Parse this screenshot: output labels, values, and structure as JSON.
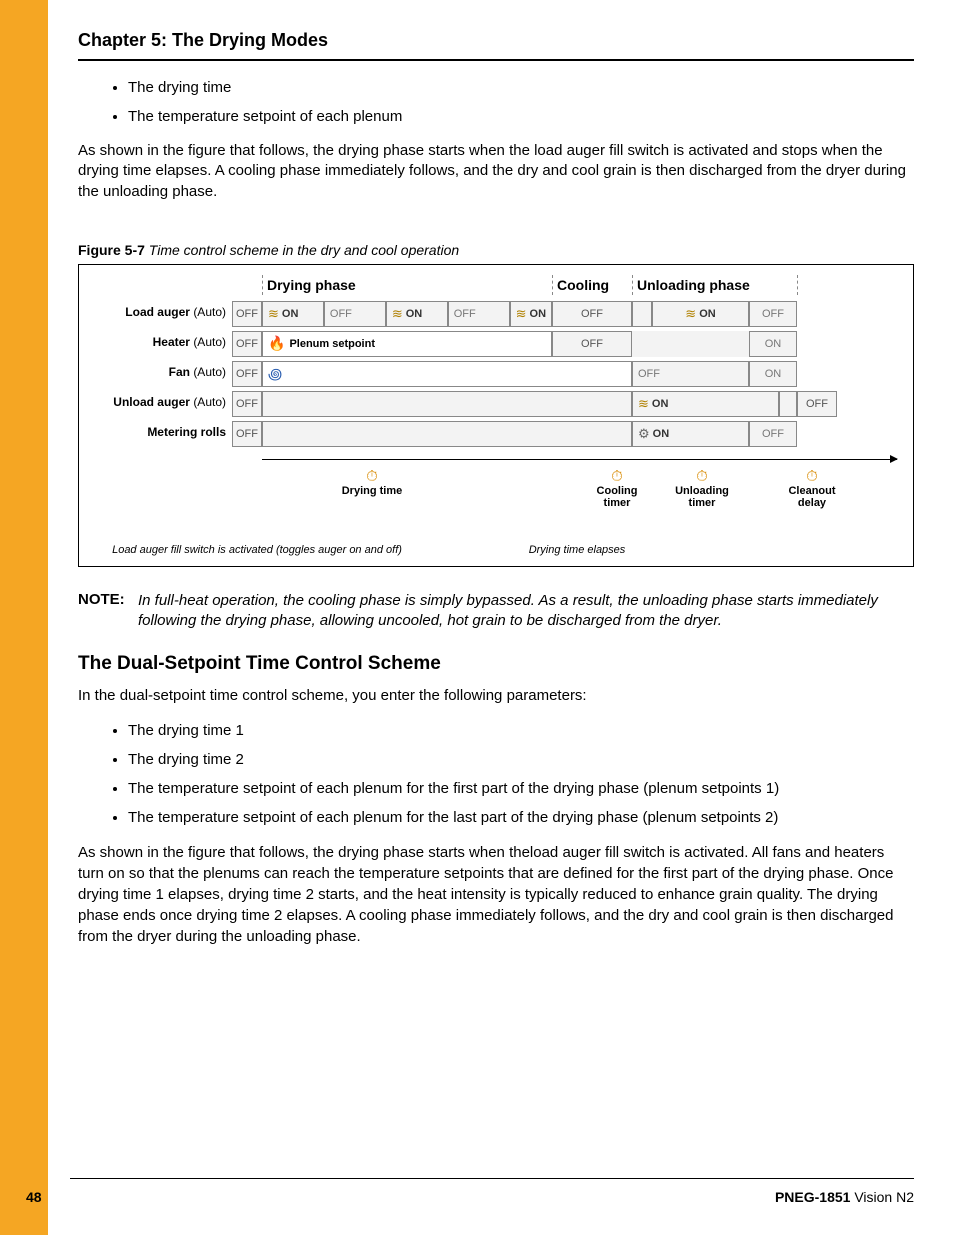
{
  "chapter_title": "Chapter 5: The Drying Modes",
  "intro_bullets": [
    "The drying time",
    "The temperature setpoint of each plenum"
  ],
  "intro_para": "As shown in the figure that follows, the drying phase starts when the load auger fill switch is activated and stops when the drying time elapses. A cooling phase immediately follows, and the dry and cool grain is then discharged from the dryer during the unloading phase.",
  "figure": {
    "label": "Figure 5-7",
    "caption": "Time control scheme in the dry and cool operation",
    "phases": {
      "drying": "Drying phase",
      "cooling": "Cooling",
      "unloading": "Unloading phase"
    },
    "rows": {
      "load_auger": {
        "label": "Load auger",
        "mode": "(Auto)"
      },
      "heater": {
        "label": "Heater",
        "mode": "(Auto)",
        "setpoint": "Plenum setpoint"
      },
      "fan": {
        "label": "Fan",
        "mode": "(Auto)"
      },
      "unload_auger": {
        "label": "Unload auger",
        "mode": "(Auto)"
      },
      "metering": {
        "label": "Metering rolls"
      }
    },
    "states": {
      "on": "ON",
      "off": "OFF"
    },
    "timers": {
      "drying": "Drying time",
      "cooling": "Cooling timer",
      "unloading": "Unloading timer",
      "cleanout": "Cleanout delay"
    },
    "footnotes": {
      "fill_switch": "Load auger fill switch is activated (toggles auger on and off)",
      "elapses": "Drying time elapses"
    }
  },
  "note": {
    "label": "NOTE:",
    "body": "In full-heat operation, the cooling phase is simply bypassed. As a result, the unloading phase starts immediately following the drying phase, allowing uncooled, hot grain to be discharged from the dryer."
  },
  "section2": {
    "heading": "The Dual-Setpoint Time Control Scheme",
    "intro": "In the dual-setpoint time control scheme, you enter the following parameters:",
    "bullets": [
      "The drying time 1",
      "The drying time 2",
      "The temperature setpoint of each plenum for the first part of the drying phase (plenum setpoints 1)",
      "The temperature setpoint of each plenum for the last part of the drying phase (plenum setpoints 2)"
    ],
    "para": "As shown in the figure that follows, the drying phase starts when theload auger fill switch is activated. All fans and heaters turn on so that the plenums can reach the temperature setpoints that are defined for the first part of the drying phase. Once drying time 1 elapses, drying time 2 starts, and the heat intensity is typically reduced to enhance grain quality. The drying phase ends once drying time 2 elapses. A cooling phase immediately follows, and the dry and cool grain is then discharged from the dryer during the unloading phase."
  },
  "footer": {
    "page": "48",
    "doc_id": "PNEG-1851",
    "doc_title": "Vision N2"
  }
}
